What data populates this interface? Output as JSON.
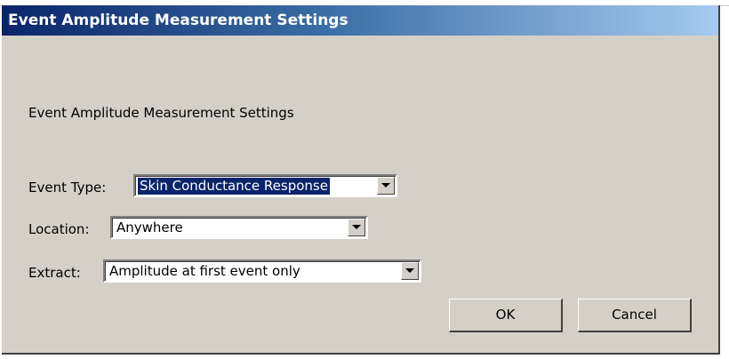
{
  "window": {
    "title": "Event Amplitude Measurement Settings"
  },
  "main": {
    "heading": "Event Amplitude Measurement Settings"
  },
  "form": {
    "event_type": {
      "label": "Event Type:",
      "value": "Skin Conductance Response"
    },
    "location": {
      "label": "Location:",
      "value": "Anywhere"
    },
    "extract": {
      "label": "Extract:",
      "value": "Amplitude at first event only"
    }
  },
  "buttons": {
    "ok_label": "OK",
    "cancel_label": "Cancel"
  },
  "icons": {
    "dropdown": "chevron-down-icon"
  },
  "colors": {
    "title_start": "#0a246a",
    "title_end": "#a6caf0",
    "dialog_bg": "#d4d0c8",
    "selection_bg": "#0a246a"
  }
}
